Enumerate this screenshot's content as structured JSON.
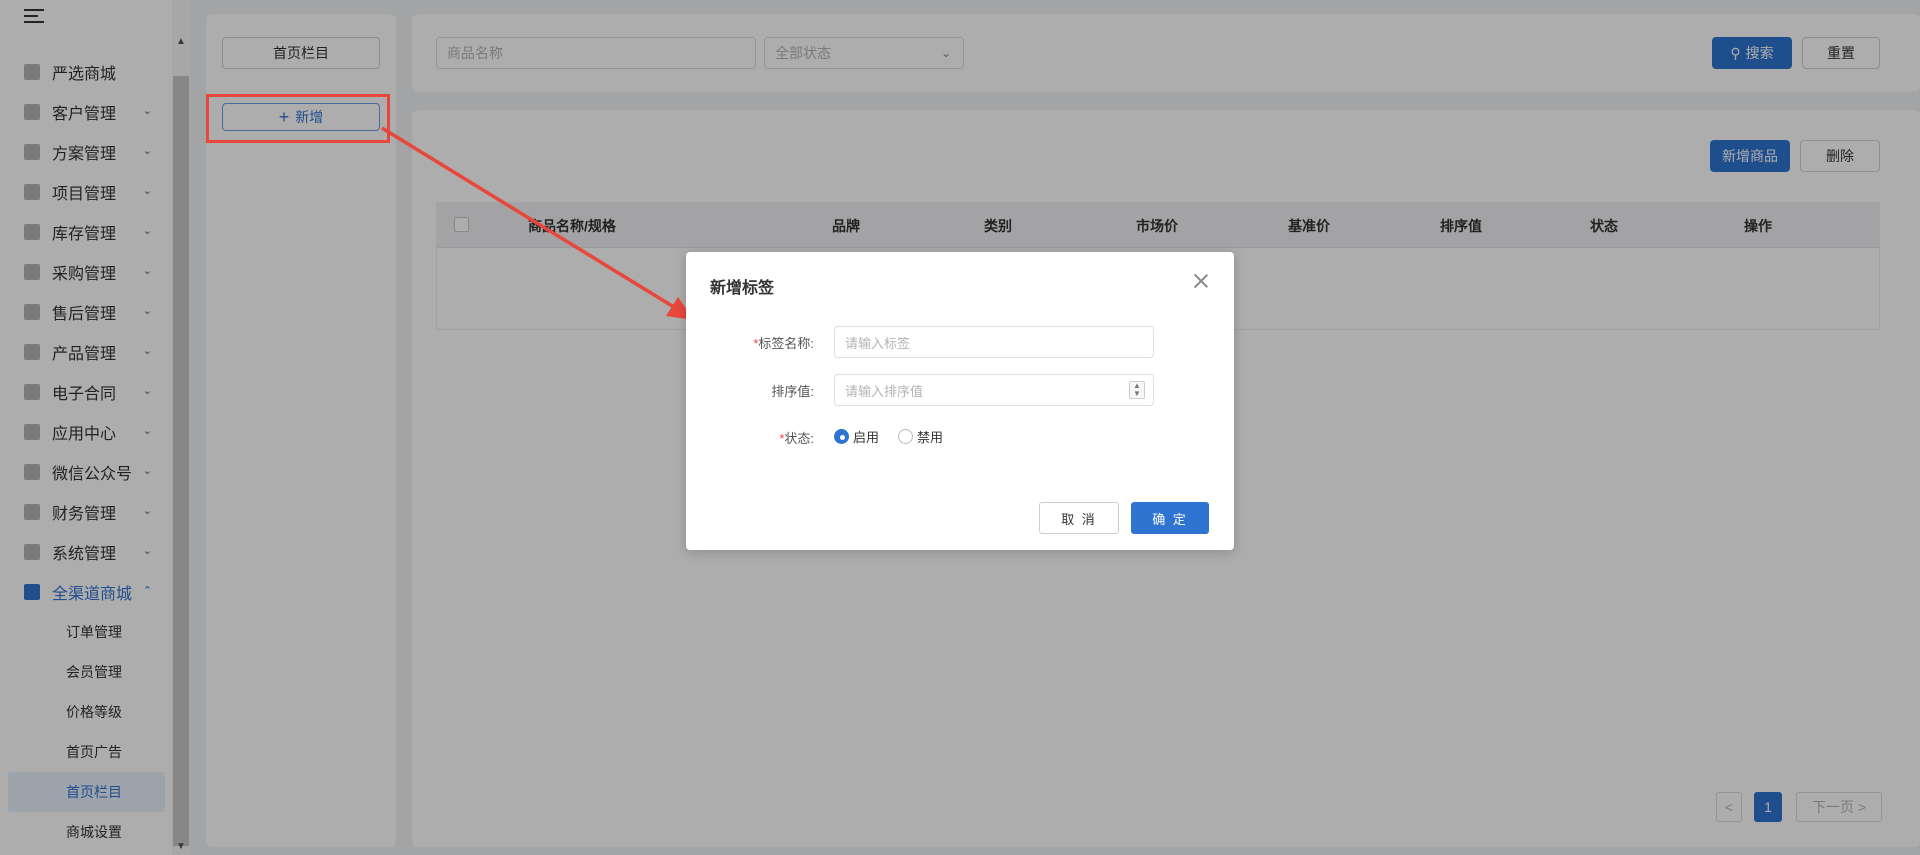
{
  "sidebar": {
    "menu": [
      {
        "label": "严选商城",
        "icon": "mall-icon",
        "chevron": ""
      },
      {
        "label": "客户管理",
        "icon": "customer-icon",
        "chevron": "v"
      },
      {
        "label": "方案管理",
        "icon": "plan-icon",
        "chevron": "v"
      },
      {
        "label": "项目管理",
        "icon": "folder-icon",
        "chevron": "v"
      },
      {
        "label": "库存管理",
        "icon": "inventory-icon",
        "chevron": "v"
      },
      {
        "label": "采购管理",
        "icon": "cart-icon",
        "chevron": "v"
      },
      {
        "label": "售后管理",
        "icon": "headset-icon",
        "chevron": "v"
      },
      {
        "label": "产品管理",
        "icon": "box-icon",
        "chevron": "v"
      },
      {
        "label": "电子合同",
        "icon": "contract-icon",
        "chevron": "v"
      },
      {
        "label": "应用中心",
        "icon": "apps-icon",
        "chevron": "v"
      },
      {
        "label": "微信公众号",
        "icon": "wechat-icon",
        "chevron": "v"
      },
      {
        "label": "财务管理",
        "icon": "finance-icon",
        "chevron": "v"
      },
      {
        "label": "系统管理",
        "icon": "settings-icon",
        "chevron": "v"
      },
      {
        "label": "全渠道商城",
        "icon": "store-icon",
        "chevron": "^"
      }
    ],
    "submenu": [
      "订单管理",
      "会员管理",
      "价格等级",
      "首页广告",
      "首页栏目",
      "商城设置"
    ]
  },
  "columns": {
    "homepage_column": "首页栏目",
    "add_label": "新增"
  },
  "search": {
    "name_placeholder": "商品名称",
    "status_placeholder": "全部状态",
    "search_label": "搜索",
    "reset_label": "重置"
  },
  "table": {
    "add_product_label": "新增商品",
    "delete_label": "删除",
    "headers": [
      "商品名称/规格",
      "品牌",
      "类别",
      "市场价",
      "基准价",
      "排序值",
      "状态",
      "操作"
    ]
  },
  "pagination": {
    "prev": "<",
    "current": "1",
    "next": "下一页 >"
  },
  "dialog": {
    "title": "新增标签",
    "name_label": "标签名称:",
    "name_placeholder": "请输入标签",
    "sort_label": "排序值:",
    "sort_placeholder": "请输入排序值",
    "status_label": "状态:",
    "required_mark": "*",
    "options": [
      "启用",
      "禁用"
    ],
    "selected": "启用",
    "cancel_label": "取 消",
    "ok_label": "确 定"
  },
  "colors": {
    "primary": "#2f74d0",
    "annotation_red": "#e8473b"
  }
}
